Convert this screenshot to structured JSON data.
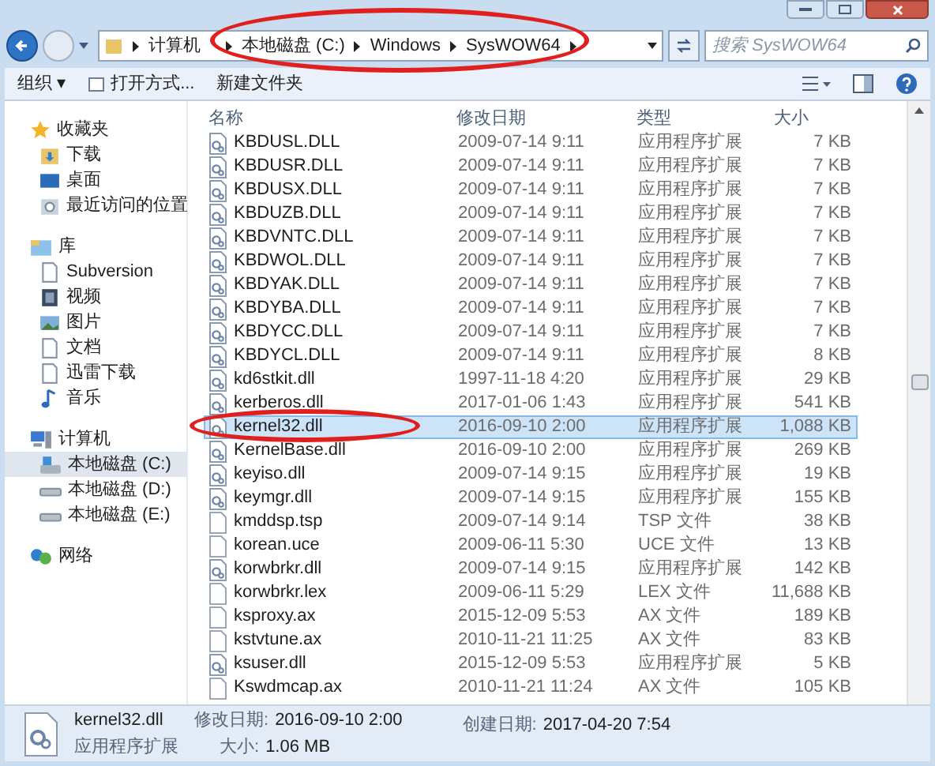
{
  "address_bar": {
    "crumbs": [
      "计算机",
      "本地磁盘 (C:)",
      "Windows",
      "SysWOW64"
    ],
    "circled": true
  },
  "search": {
    "placeholder": "搜索 SysWOW64"
  },
  "toolbar": {
    "buttons": [
      "组织 ▾",
      "打开方式...",
      "新建文件夹"
    ]
  },
  "navigation": [
    {
      "label": "收藏夹",
      "kind": "star",
      "selected": false,
      "children": [
        {
          "label": "下载",
          "kind": "download",
          "selected": false
        },
        {
          "label": "桌面",
          "kind": "desktop",
          "selected": false
        },
        {
          "label": "最近访问的位置",
          "kind": "recent",
          "selected": false
        }
      ]
    },
    {
      "label": "库",
      "kind": "library",
      "selected": false,
      "children": [
        {
          "label": "Subversion",
          "kind": "doc",
          "selected": false
        },
        {
          "label": "视频",
          "kind": "video",
          "selected": false
        },
        {
          "label": "图片",
          "kind": "image",
          "selected": false
        },
        {
          "label": "文档",
          "kind": "doc",
          "selected": false
        },
        {
          "label": "迅雷下载",
          "kind": "doc",
          "selected": false
        },
        {
          "label": "音乐",
          "kind": "music",
          "selected": false
        }
      ]
    },
    {
      "label": "计算机",
      "kind": "computer",
      "selected": false,
      "children": [
        {
          "label": "本地磁盘 (C:)",
          "kind": "system-drive",
          "selected": true
        },
        {
          "label": "本地磁盘 (D:)",
          "kind": "drive",
          "selected": false
        },
        {
          "label": "本地磁盘 (E:)",
          "kind": "drive",
          "selected": false
        }
      ]
    },
    {
      "label": "网络",
      "kind": "network",
      "selected": false
    }
  ],
  "table": {
    "columns": [
      "名称",
      "修改日期",
      "类型",
      "大小"
    ],
    "rows": [
      {
        "name": "KBDUSL.DLL",
        "date": "2009-07-14 9:11",
        "type": "应用程序扩展",
        "size": "7 KB",
        "kind": "dll",
        "selected": false
      },
      {
        "name": "KBDUSR.DLL",
        "date": "2009-07-14 9:11",
        "type": "应用程序扩展",
        "size": "7 KB",
        "kind": "dll",
        "selected": false
      },
      {
        "name": "KBDUSX.DLL",
        "date": "2009-07-14 9:11",
        "type": "应用程序扩展",
        "size": "7 KB",
        "kind": "dll",
        "selected": false
      },
      {
        "name": "KBDUZB.DLL",
        "date": "2009-07-14 9:11",
        "type": "应用程序扩展",
        "size": "7 KB",
        "kind": "dll",
        "selected": false
      },
      {
        "name": "KBDVNTC.DLL",
        "date": "2009-07-14 9:11",
        "type": "应用程序扩展",
        "size": "7 KB",
        "kind": "dll",
        "selected": false
      },
      {
        "name": "KBDWOL.DLL",
        "date": "2009-07-14 9:11",
        "type": "应用程序扩展",
        "size": "7 KB",
        "kind": "dll",
        "selected": false
      },
      {
        "name": "KBDYAK.DLL",
        "date": "2009-07-14 9:11",
        "type": "应用程序扩展",
        "size": "7 KB",
        "kind": "dll",
        "selected": false
      },
      {
        "name": "KBDYBA.DLL",
        "date": "2009-07-14 9:11",
        "type": "应用程序扩展",
        "size": "7 KB",
        "kind": "dll",
        "selected": false
      },
      {
        "name": "KBDYCC.DLL",
        "date": "2009-07-14 9:11",
        "type": "应用程序扩展",
        "size": "7 KB",
        "kind": "dll",
        "selected": false
      },
      {
        "name": "KBDYCL.DLL",
        "date": "2009-07-14 9:11",
        "type": "应用程序扩展",
        "size": "8 KB",
        "kind": "dll",
        "selected": false
      },
      {
        "name": "kd6stkit.dll",
        "date": "1997-11-18 4:20",
        "type": "应用程序扩展",
        "size": "29 KB",
        "kind": "dll",
        "selected": false
      },
      {
        "name": "kerberos.dll",
        "date": "2017-01-06 1:43",
        "type": "应用程序扩展",
        "size": "541 KB",
        "kind": "dll",
        "selected": false
      },
      {
        "name": "kernel32.dll",
        "date": "2016-09-10 2:00",
        "type": "应用程序扩展",
        "size": "1,088 KB",
        "kind": "dll",
        "selected": true,
        "circled": true
      },
      {
        "name": "KernelBase.dll",
        "date": "2016-09-10 2:00",
        "type": "应用程序扩展",
        "size": "269 KB",
        "kind": "dll",
        "selected": false
      },
      {
        "name": "keyiso.dll",
        "date": "2009-07-14 9:15",
        "type": "应用程序扩展",
        "size": "19 KB",
        "kind": "dll",
        "selected": false
      },
      {
        "name": "keymgr.dll",
        "date": "2009-07-14 9:15",
        "type": "应用程序扩展",
        "size": "155 KB",
        "kind": "dll",
        "selected": false
      },
      {
        "name": "kmddsp.tsp",
        "date": "2009-07-14 9:14",
        "type": "TSP 文件",
        "size": "38 KB",
        "kind": "file",
        "selected": false
      },
      {
        "name": "korean.uce",
        "date": "2009-06-11 5:30",
        "type": "UCE 文件",
        "size": "13 KB",
        "kind": "file",
        "selected": false
      },
      {
        "name": "korwbrkr.dll",
        "date": "2009-07-14 9:15",
        "type": "应用程序扩展",
        "size": "142 KB",
        "kind": "dll",
        "selected": false
      },
      {
        "name": "korwbrkr.lex",
        "date": "2009-06-11 5:29",
        "type": "LEX 文件",
        "size": "11,688 KB",
        "kind": "file",
        "selected": false
      },
      {
        "name": "ksproxy.ax",
        "date": "2015-12-09 5:53",
        "type": "AX 文件",
        "size": "189 KB",
        "kind": "file",
        "selected": false
      },
      {
        "name": "kstvtune.ax",
        "date": "2010-11-21 11:25",
        "type": "AX 文件",
        "size": "83 KB",
        "kind": "file",
        "selected": false
      },
      {
        "name": "ksuser.dll",
        "date": "2015-12-09 5:53",
        "type": "应用程序扩展",
        "size": "5 KB",
        "kind": "dll",
        "selected": false
      },
      {
        "name": "Kswdmcap.ax",
        "date": "2010-11-21 11:24",
        "type": "AX 文件",
        "size": "105 KB",
        "kind": "file",
        "selected": false
      }
    ]
  },
  "details_pane": {
    "name": "kernel32.dll",
    "type": "应用程序扩展",
    "modified_label": "修改日期:",
    "modified": "2016-09-10 2:00",
    "size_label": "大小:",
    "size": "1.06 MB",
    "created_label": "创建日期:",
    "created": "2017-04-20 7:54"
  }
}
